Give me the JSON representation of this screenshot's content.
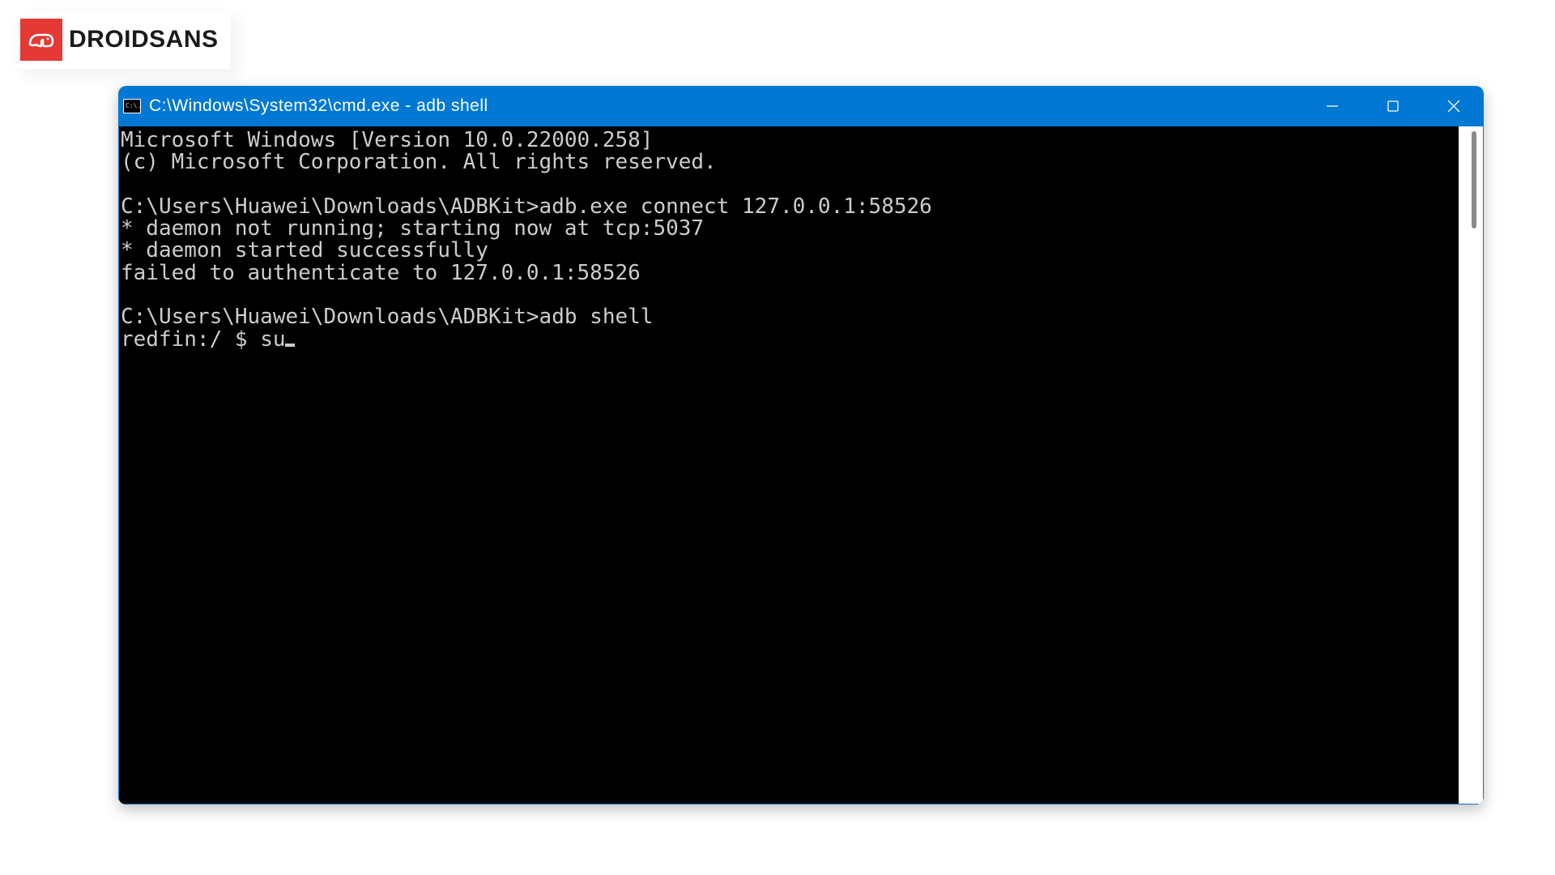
{
  "logo": {
    "brand_text": "DROIDSANS"
  },
  "window": {
    "icon_text": "C:\\.",
    "title": "C:\\Windows\\System32\\cmd.exe - adb  shell"
  },
  "terminal": {
    "lines": [
      "Microsoft Windows [Version 10.0.22000.258]",
      "(c) Microsoft Corporation. All rights reserved.",
      "",
      "C:\\Users\\Huawei\\Downloads\\ADBKit>adb.exe connect 127.0.0.1:58526",
      "* daemon not running; starting now at tcp:5037",
      "* daemon started successfully",
      "failed to authenticate to 127.0.0.1:58526",
      "",
      "C:\\Users\\Huawei\\Downloads\\ADBKit>adb shell"
    ],
    "current_prompt": "redfin:/ $ ",
    "current_input": "su"
  }
}
